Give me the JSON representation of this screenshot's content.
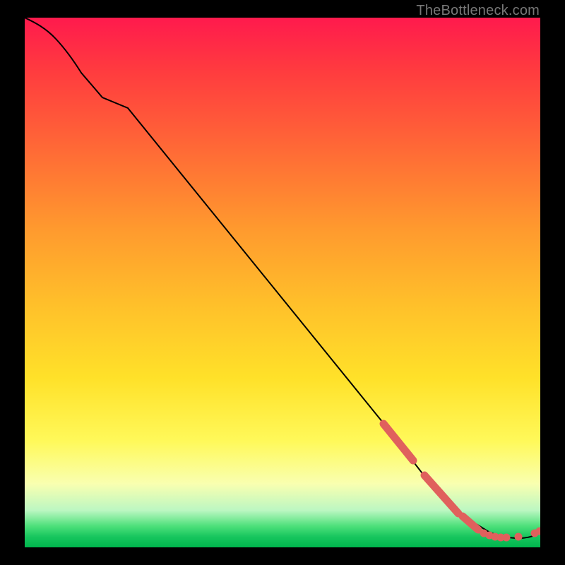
{
  "attribution": "TheBottleneck.com",
  "colors": {
    "dot": "#e0605d",
    "line": "#000000",
    "background_black": "#000000"
  },
  "chart_data": {
    "type": "line",
    "title": "",
    "xlabel": "",
    "ylabel": "",
    "xlim": [
      0,
      100
    ],
    "ylim": [
      0,
      100
    ],
    "grid": false,
    "legend": false,
    "series": [
      {
        "name": "bottleneck-curve",
        "x": [
          0,
          3,
          6,
          10,
          15,
          20,
          30,
          40,
          50,
          60,
          70,
          78,
          80,
          85,
          90,
          95,
          98,
          100
        ],
        "y": [
          100,
          99,
          97,
          94,
          89,
          83,
          71,
          59,
          47,
          35,
          23,
          13,
          11,
          6,
          3,
          2,
          2,
          3
        ]
      }
    ],
    "highlighted_points": [
      {
        "x": 70,
        "y": 23,
        "label": "segment-start-a"
      },
      {
        "x": 71,
        "y": 22
      },
      {
        "x": 72,
        "y": 21
      },
      {
        "x": 73,
        "y": 19
      },
      {
        "x": 74,
        "y": 18
      },
      {
        "x": 75,
        "y": 17
      },
      {
        "x": 78,
        "y": 13,
        "label": "segment-start-b"
      },
      {
        "x": 79,
        "y": 12
      },
      {
        "x": 80,
        "y": 11
      },
      {
        "x": 81,
        "y": 10
      },
      {
        "x": 82,
        "y": 9
      },
      {
        "x": 83,
        "y": 8
      },
      {
        "x": 84,
        "y": 7
      },
      {
        "x": 85,
        "y": 6,
        "label": "segment-start-c"
      },
      {
        "x": 86,
        "y": 5
      },
      {
        "x": 87,
        "y": 4
      },
      {
        "x": 88,
        "y": 3,
        "label": "flat-start"
      },
      {
        "x": 89,
        "y": 3
      },
      {
        "x": 90,
        "y": 2
      },
      {
        "x": 91,
        "y": 2
      },
      {
        "x": 92,
        "y": 2
      },
      {
        "x": 93,
        "y": 2,
        "label": "gap"
      },
      {
        "x": 95,
        "y": 2
      },
      {
        "x": 96,
        "y": 2,
        "label": "gap"
      },
      {
        "x": 99,
        "y": 3
      },
      {
        "x": 100,
        "y": 3,
        "label": "flat-end"
      }
    ]
  }
}
